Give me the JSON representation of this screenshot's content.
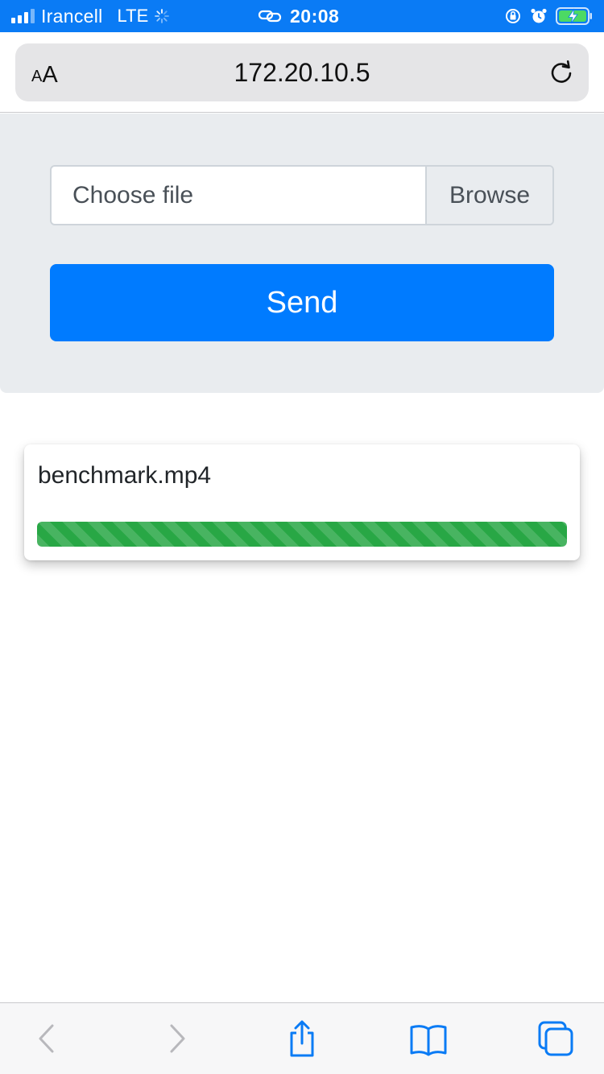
{
  "status_bar": {
    "carrier": "Irancell",
    "network": "LTE",
    "time": "20:08",
    "background": "#0a7bf5",
    "icons": [
      "signal-bars-icon",
      "loading-spinner-icon",
      "personal-hotspot-icon",
      "orientation-lock-icon",
      "alarm-icon",
      "battery-charging-icon"
    ]
  },
  "address_bar": {
    "text_size_label_small": "A",
    "text_size_label_large": "A",
    "url": "172.20.10.5",
    "reload_icon": "reload-icon"
  },
  "upload_form": {
    "file_placeholder": "Choose file",
    "browse_label": "Browse",
    "send_label": "Send",
    "send_color": "#007bff"
  },
  "upload_item": {
    "file_name": "benchmark.mp4",
    "progress": 1.0,
    "progress_color": "#28a745"
  },
  "toolbar": {
    "items": [
      "back-icon",
      "forward-icon",
      "share-icon",
      "bookmarks-icon",
      "tabs-icon"
    ],
    "accent": "#0a7bf5"
  }
}
